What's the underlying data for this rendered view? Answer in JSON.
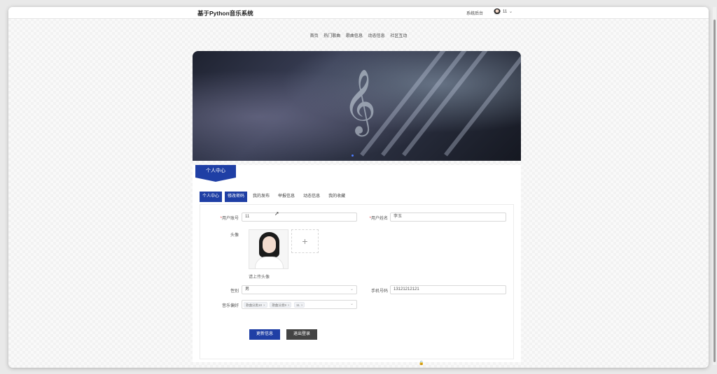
{
  "header": {
    "app_title": "基于Python音乐系统",
    "admin_link": "系统后台",
    "user_name": "11",
    "chevron": "⌄"
  },
  "nav": {
    "items": [
      "首页",
      "热门歌曲",
      "歌曲信息",
      "动态信息",
      "社区互动"
    ]
  },
  "banner": {
    "clef": "𝄞"
  },
  "panel": {
    "ribbon": "个人中心",
    "tabs": [
      {
        "label": "个人中心",
        "active": true
      },
      {
        "label": "修改密码",
        "active": true
      },
      {
        "label": "我的发布",
        "active": false
      },
      {
        "label": "举报信息",
        "active": false
      },
      {
        "label": "动态信息",
        "active": false
      },
      {
        "label": "我的收藏",
        "active": false
      }
    ]
  },
  "form": {
    "account_label": "用户账号",
    "account_value": "11",
    "name_label": "用户姓名",
    "name_value": "李玉",
    "avatar_label": "头像",
    "upload_plus": "+",
    "avatar_hint": "请上传头像",
    "gender_label": "性别",
    "gender_value": "男",
    "phone_label": "手机号码",
    "phone_value": "13121212121",
    "pref_label": "音乐偏好",
    "pref_tags": [
      "歌曲分类10",
      "歌曲分类9",
      "11"
    ],
    "update_button": "更新信息",
    "logout_button": "退出登录",
    "required_mark": "*"
  },
  "colors": {
    "accent": "#1f3fa5",
    "dark_button": "#444444"
  }
}
